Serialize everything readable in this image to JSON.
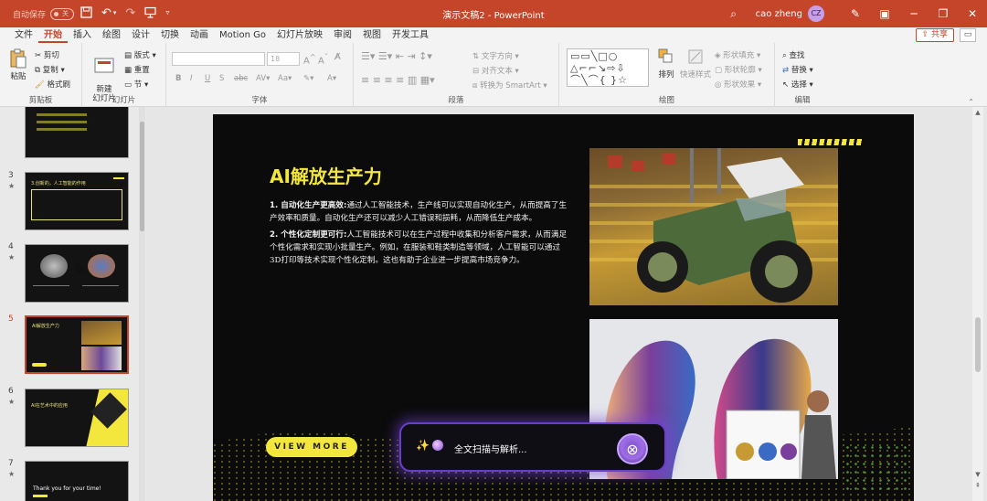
{
  "titlebar": {
    "autosave_label": "自动保存",
    "autosave_state": "关",
    "doc_title": "演示文稿2  -  PowerPoint",
    "user_name": "cao zheng",
    "user_initials": "CZ",
    "qat_icons": [
      "save-icon",
      "undo-icon",
      "redo-icon",
      "present-icon",
      "customize-icon"
    ]
  },
  "menu": {
    "items": [
      "文件",
      "开始",
      "插入",
      "绘图",
      "设计",
      "切换",
      "动画",
      "Motion Go",
      "幻灯片放映",
      "审阅",
      "视图",
      "开发工具"
    ],
    "active": "开始",
    "share_label": "共享"
  },
  "ribbon": {
    "clipboard": {
      "paste": "粘贴",
      "cut": "剪切",
      "copy": "复制",
      "format_painter": "格式刷",
      "label": "剪贴板"
    },
    "slides": {
      "new_slide": "新建\n幻灯片",
      "layout": "版式",
      "reset": "重置",
      "section": "节",
      "label": "幻灯片"
    },
    "font": {
      "font_name": "",
      "font_size": "18",
      "bold": "B",
      "italic": "I",
      "underline": "U",
      "strike": "S",
      "label": "字体"
    },
    "paragraph": {
      "text_direction": "文字方向",
      "align_text": "对齐文本",
      "smartart": "转换为 SmartArt",
      "label": "段落"
    },
    "drawing": {
      "arrange": "排列",
      "quick_styles": "快速样式",
      "shape_fill": "形状填充",
      "shape_outline": "形状轮廓",
      "shape_effects": "形状效果",
      "label": "绘图"
    },
    "editing": {
      "find": "查找",
      "replace": "替换",
      "select": "选择",
      "label": "编辑"
    }
  },
  "thumbnails": [
    {
      "num": "3",
      "star": "★",
      "title": "3.创新的，人工智能的作用"
    },
    {
      "num": "4",
      "star": "★",
      "title": ""
    },
    {
      "num": "5",
      "star": "",
      "title": "AI解放生产力",
      "active": true
    },
    {
      "num": "6",
      "star": "★",
      "title": "AI在艺术中的应用"
    },
    {
      "num": "7",
      "star": "★",
      "title": "Thank you for your time!"
    }
  ],
  "slide": {
    "title": "AI解放生产力",
    "p1_lead": "1. 自动化生产更高效:",
    "p1_body": "通过人工智能技术，生产线可以实现自动化生产，从而提高了生产效率和质量。自动化生产还可以减少人工错误和损耗，从而降低生产成本。",
    "p2_lead": "2. 个性化定制更可行:",
    "p2_body": "人工智能技术可以在生产过程中收集和分析客户需求，从而满足个性化需求和实现小批量生产。例如，在服装和鞋类制造等领域，人工智能可以通过3D打印等技术实现个性化定制。这也有助于企业进一步提高市场竞争力。",
    "button": "VIEW MORE"
  },
  "ai_popup": {
    "status": "全文扫描与解析..."
  },
  "colors": {
    "accent": "#c4452a",
    "slide_yellow": "#f3e73d",
    "popup_glow": "#6a3fc8"
  }
}
